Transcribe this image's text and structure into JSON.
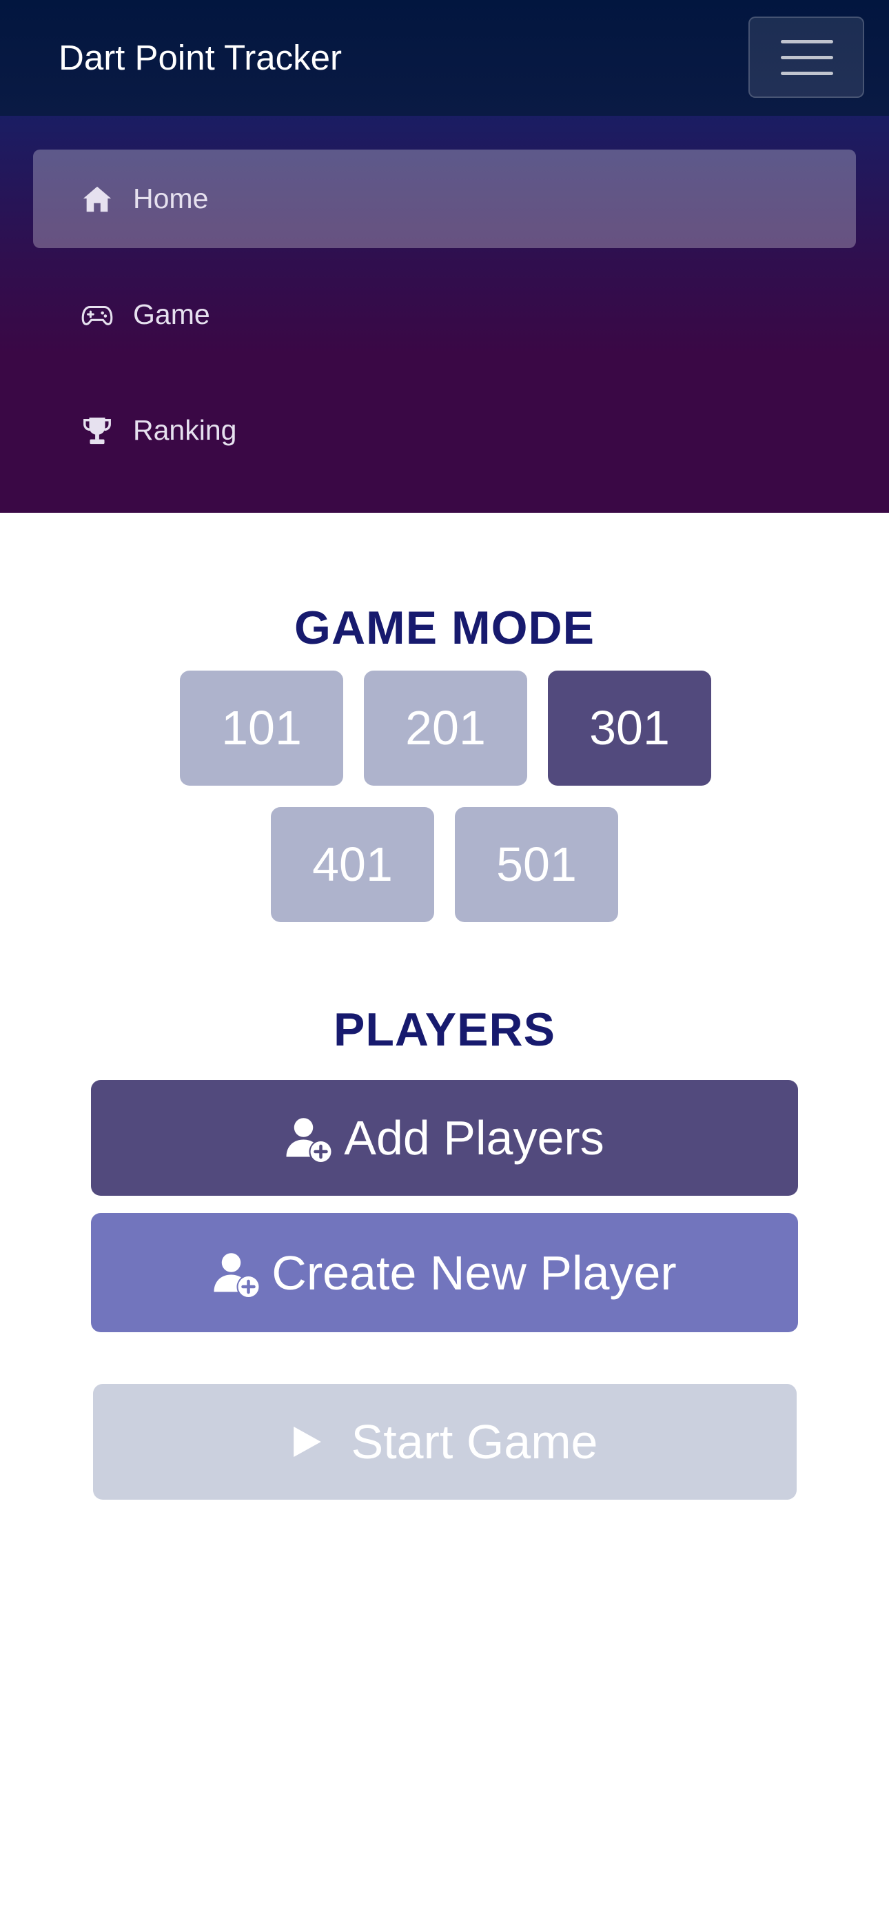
{
  "navbar": {
    "brand": "Dart Point Tracker",
    "toggle_icon": "hamburger-menu-icon"
  },
  "menu": {
    "items": [
      {
        "label": "Home",
        "icon": "home-icon",
        "active": true
      },
      {
        "label": "Game",
        "icon": "gamepad-icon",
        "active": false
      },
      {
        "label": "Ranking",
        "icon": "trophy-icon",
        "active": false
      }
    ]
  },
  "game_mode": {
    "title": "GAME MODE",
    "options": [
      "101",
      "201",
      "301",
      "401",
      "501"
    ],
    "selected": "301"
  },
  "players": {
    "title": "PLAYERS",
    "add_label": "Add Players",
    "create_label": "Create New Player",
    "add_icon": "user-plus-icon",
    "create_icon": "user-plus-icon"
  },
  "start": {
    "label": "Start Game",
    "icon": "play-icon",
    "disabled": true
  },
  "colors": {
    "navbar_bg": "#02163f",
    "menu_gradient_top": "#1a1d63",
    "menu_gradient_bottom": "#3a0845",
    "heading": "#171a6e",
    "mode_button": "#aeb3cc",
    "mode_button_selected": "#524a7d",
    "add_players": "#524a7d",
    "create_player": "#7275bd",
    "start_game_disabled": "#cbd0de"
  }
}
